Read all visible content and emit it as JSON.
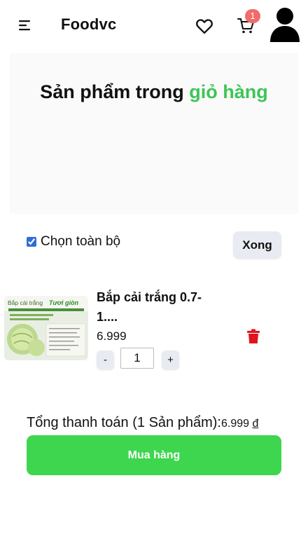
{
  "header": {
    "brand": "Foodvc",
    "cart_count": "1",
    "icons": [
      "menu-icon",
      "heart-icon",
      "cart-icon",
      "user-avatar-icon"
    ]
  },
  "hero": {
    "title_part1": "Sản phẩm trong ",
    "title_accent": "giỏ hàng",
    "accent_color": "#3dc556"
  },
  "cart": {
    "select_all_label": "Chọn toàn bộ",
    "select_all_checked": true,
    "done_label": "Xong",
    "items": [
      {
        "name": "Bắp cải trắng 0.7-1....",
        "price": "6.999",
        "quantity": "1",
        "minus_label": "-",
        "plus_label": "+",
        "thumb_text": "Bắp cải trắng",
        "thumb_accent": "Tươi giòn"
      }
    ]
  },
  "summary": {
    "total_label": "Tổng thanh toán (1 Sản phẩm):",
    "total_amount": "6.999 ",
    "currency": "đ",
    "buy_label": "Mua hàng",
    "buy_color": "#3dd64e"
  }
}
